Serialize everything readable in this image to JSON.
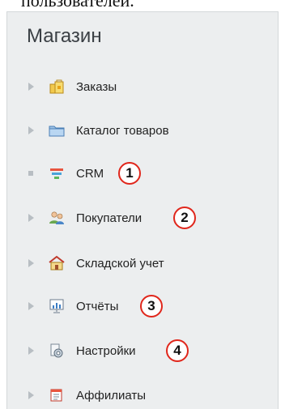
{
  "header_fragment": "пользователей.",
  "shop": {
    "title": "Магазин",
    "items": [
      {
        "label": "Заказы",
        "icon": "shopping-bags-icon",
        "bullet": "arrow"
      },
      {
        "label": "Каталог товаров",
        "icon": "folder-icon",
        "bullet": "arrow"
      },
      {
        "label": "CRM",
        "icon": "funnel-icon",
        "bullet": "dot",
        "badge": "1"
      },
      {
        "label": "Покупатели",
        "icon": "users-icon",
        "bullet": "arrow",
        "badge": "2"
      },
      {
        "label": "Складской учет",
        "icon": "warehouse-icon",
        "bullet": "arrow"
      },
      {
        "label": "Отчёты",
        "icon": "report-chart-icon",
        "bullet": "arrow",
        "badge": "3"
      },
      {
        "label": "Настройки",
        "icon": "settings-gear-icon",
        "bullet": "arrow",
        "badge": "4"
      },
      {
        "label": "Аффилиаты",
        "icon": "affiliates-icon",
        "bullet": "arrow"
      }
    ]
  },
  "colors": {
    "badge_border": "#e0261b",
    "panel_bg": "#eceeef",
    "arrow": "#b8bec3"
  }
}
